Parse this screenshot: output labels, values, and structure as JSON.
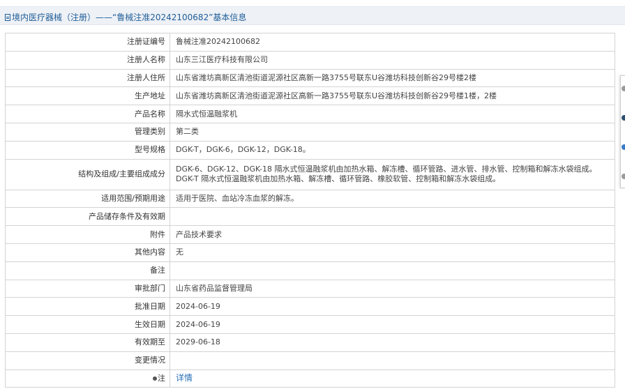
{
  "header": {
    "title": "境内医疗器械（注册）——“鲁械注准20242100682”基本信息"
  },
  "colors": {
    "header_bg": "#eef1f5",
    "title_text": "#1f5d99",
    "link": "#2a6fb5",
    "border": "#d3d3d3"
  },
  "rows": [
    {
      "label": "注册证编号",
      "value": "鲁械注准20242100682"
    },
    {
      "label": "注册人名称",
      "value": "山东三江医疗科技有限公司"
    },
    {
      "label": "注册人住所",
      "value": "山东省潍坊高新区清池街道泥源社区高新一路3755号联东U谷潍坊科技创新谷29号楼2楼"
    },
    {
      "label": "生产地址",
      "value": "山东省潍坊高新区清池街道泥源社区高新一路3755号联东U谷潍坊科技创新谷29号楼1楼，2楼"
    },
    {
      "label": "产品名称",
      "value": "隔水式恒温融浆机"
    },
    {
      "label": "管理类别",
      "value": "第二类"
    },
    {
      "label": "型号规格",
      "value": "DGK-T，DGK-6，DGK-12，DGK-18。"
    },
    {
      "label": "结构及组成/主要组成成分",
      "value": "DGK-6、DGK-12、DGK-18 隔水式恒温融浆机由加热水箱、解冻槽、循环管路、进水管、排水管、控制箱和解冻水袋组成。DGK-T 隔水式恒温融浆机由加热水箱、解冻槽、循环管路、橡胶软管、控制箱和解冻水袋组成。"
    },
    {
      "label": "适用范围/预期用途",
      "value": "适用于医院、血站冷冻血浆的解冻。"
    },
    {
      "label": "产品储存条件及有效期",
      "value": ""
    },
    {
      "label": "附件",
      "value": "产品技术要求"
    },
    {
      "label": "其他内容",
      "value": "无"
    },
    {
      "label": "备注",
      "value": ""
    },
    {
      "label": "审批部门",
      "value": "山东省药品监督管理局"
    },
    {
      "label": "批准日期",
      "value": "2024-06-19"
    },
    {
      "label": "生效日期",
      "value": "2024-06-19"
    },
    {
      "label": "有效期至",
      "value": "2029-06-18"
    },
    {
      "label": "变更情况",
      "value": ""
    }
  ],
  "note": {
    "label": "注",
    "link_text": "详情",
    "icon": "pin-icon"
  }
}
